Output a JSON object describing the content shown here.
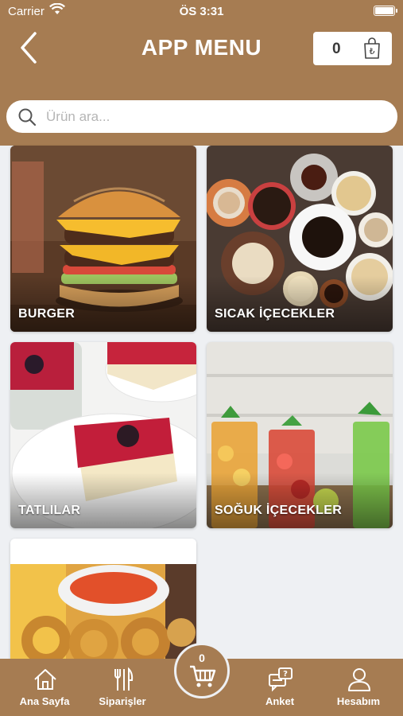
{
  "status_bar": {
    "carrier": "Carrier",
    "time": "ÖS 3:31"
  },
  "header": {
    "title": "APP MENU",
    "cart_count": "0"
  },
  "search": {
    "placeholder": "Ürün ara..."
  },
  "categories": [
    {
      "label": "BURGER"
    },
    {
      "label": "SICAK İÇECEKLER"
    },
    {
      "label": "TATLILAR"
    },
    {
      "label": "SOĞUK İÇECEKLER"
    },
    {
      "label": ""
    }
  ],
  "tabbar": {
    "home": "Ana Sayfa",
    "orders": "Siparişler",
    "cart_count": "0",
    "survey": "Anket",
    "account": "Hesabım"
  },
  "colors": {
    "brand": "#a67c52",
    "background": "#eef0f3"
  }
}
